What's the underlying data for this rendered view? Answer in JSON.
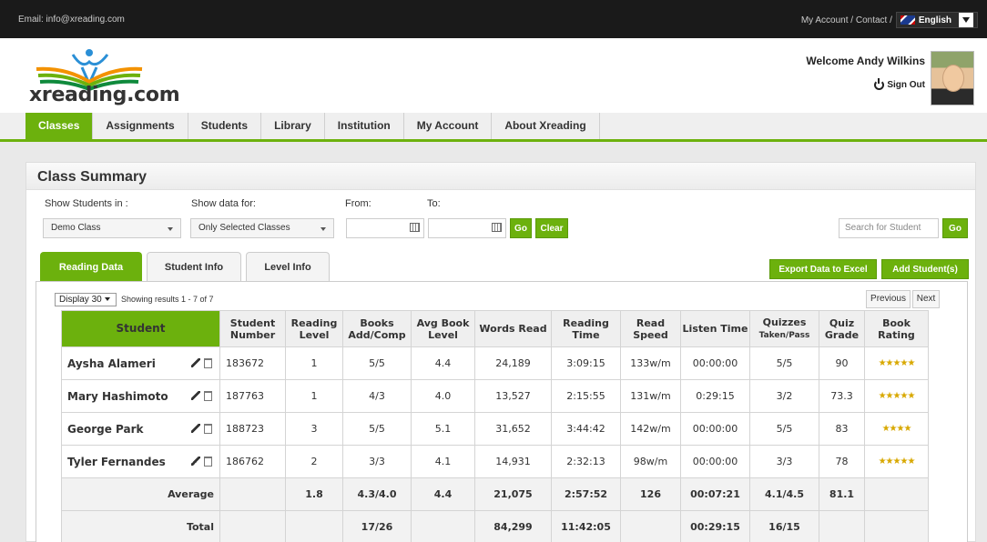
{
  "topbar": {
    "email": "Email: info@xreading.com",
    "links": "My Account / Contact /",
    "language": "English"
  },
  "header": {
    "logo_text": "xreading.com",
    "welcome": "Welcome Andy Wilkins",
    "signout": "Sign Out"
  },
  "nav": {
    "items": [
      "Classes",
      "Assignments",
      "Students",
      "Library",
      "Institution",
      "My Account",
      "About Xreading"
    ],
    "active": "Classes"
  },
  "panel": {
    "title": "Class Summary",
    "show_students_label": "Show Students in :",
    "show_data_label": "Show data for:",
    "from_label": "From:",
    "to_label": "To:",
    "class_select": "Demo Class",
    "data_select": "Only Selected Classes",
    "go": "Go",
    "clear": "Clear",
    "search_placeholder": "Search for Student",
    "search_go": "Go",
    "export": "Export Data to Excel",
    "add_student": "Add Student(s)"
  },
  "tabs": [
    "Reading Data",
    "Student Info",
    "Level Info"
  ],
  "listing": {
    "display": "Display 30",
    "showing": "Showing results 1 - 7 of 7",
    "previous": "Previous",
    "next": "Next"
  },
  "table": {
    "headers": {
      "student": "Student",
      "student_number": "Student Number",
      "reading_level": "Reading Level",
      "books": "Books Add/Comp",
      "avg_book_level": "Avg Book Level",
      "words_read": "Words Read",
      "reading_time": "Reading Time",
      "read_speed": "Read Speed",
      "listen_time": "Listen Time",
      "quizzes": "Quizzes",
      "quizzes_sub": "Taken/Pass",
      "quiz_grade": "Quiz Grade",
      "book_rating": "Book Rating"
    },
    "rows": [
      {
        "name": "Aysha Alameri",
        "number": "183672",
        "level": "1",
        "books": "5/5",
        "avg": "4.4",
        "words": "24,189",
        "time": "3:09:15",
        "speed": "133w/m",
        "listen": "00:00:00",
        "quizzes": "5/5",
        "grade": "90",
        "rating": "★★★★★"
      },
      {
        "name": "Mary Hashimoto",
        "number": "187763",
        "level": "1",
        "books": "4/3",
        "avg": "4.0",
        "words": "13,527",
        "time": "2:15:55",
        "speed": "131w/m",
        "listen": "0:29:15",
        "quizzes": "3/2",
        "grade": "73.3",
        "rating": "★★★★★"
      },
      {
        "name": "George Park",
        "number": "188723",
        "level": "3",
        "books": "5/5",
        "avg": "5.1",
        "words": "31,652",
        "time": "3:44:42",
        "speed": "142w/m",
        "listen": "00:00:00",
        "quizzes": "5/5",
        "grade": "83",
        "rating": "★★★★"
      },
      {
        "name": "Tyler Fernandes",
        "number": "186762",
        "level": "2",
        "books": "3/3",
        "avg": "4.1",
        "words": "14,931",
        "time": "2:32:13",
        "speed": "98w/m",
        "listen": "00:00:00",
        "quizzes": "3/3",
        "grade": "78",
        "rating": "★★★★★"
      }
    ],
    "average": {
      "label": "Average",
      "level": "1.8",
      "books": "4.3/4.0",
      "avg": "4.4",
      "words": "21,075",
      "time": "2:57:52",
      "speed": "126",
      "listen": "00:07:21",
      "quizzes": "4.1/4.5",
      "grade": "81.1"
    },
    "total": {
      "label": "Total",
      "books": "17/26",
      "words": "84,299",
      "time": "11:42:05",
      "listen": "00:29:15",
      "quizzes": "16/15"
    }
  },
  "colors": {
    "accent": "#6cb10d",
    "topbar": "#1a1a1a"
  }
}
